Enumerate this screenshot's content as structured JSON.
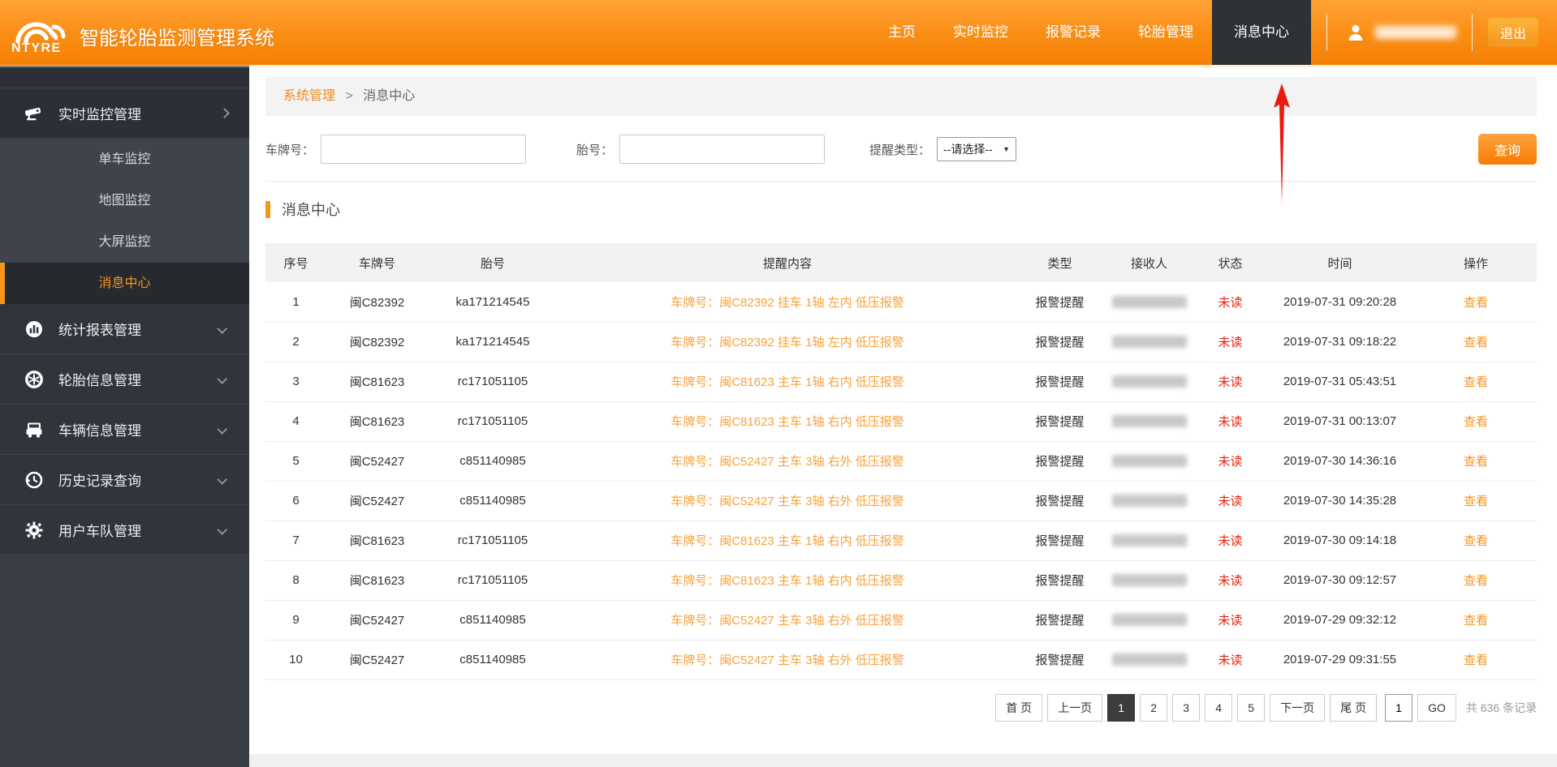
{
  "colors": {
    "accent_orange": "#f7941d",
    "header_gradient_top": "#ffa235",
    "header_gradient_bottom": "#f67f06",
    "active_tab_bg": "#2e3236",
    "status_red": "#e8240c",
    "sidebar_bg": "#383d44",
    "annotation_arrow": "#ea1b0c"
  },
  "header": {
    "logo_text": "NTYRE",
    "app_title": "智能轮胎监测管理系统",
    "nav": [
      {
        "label": "主页",
        "active": false
      },
      {
        "label": "实时监控",
        "active": false
      },
      {
        "label": "报警记录",
        "active": false
      },
      {
        "label": "轮胎管理",
        "active": false
      },
      {
        "label": "消息中心",
        "active": true
      }
    ],
    "username_redacted": true,
    "logout_label": "退出"
  },
  "sidebar": {
    "groups": [
      {
        "label": "实时监控管理",
        "icon": "cctv-camera",
        "expanded": true,
        "children": [
          {
            "label": "单车监控",
            "active": false
          },
          {
            "label": "地图监控",
            "active": false
          },
          {
            "label": "大屏监控",
            "active": false
          },
          {
            "label": "消息中心",
            "active": true
          }
        ]
      },
      {
        "label": "统计报表管理",
        "icon": "bar-chart",
        "expanded": false
      },
      {
        "label": "轮胎信息管理",
        "icon": "tire",
        "expanded": false
      },
      {
        "label": "车辆信息管理",
        "icon": "truck",
        "expanded": false
      },
      {
        "label": "历史记录查询",
        "icon": "history",
        "expanded": false
      },
      {
        "label": "用户车队管理",
        "icon": "gear",
        "expanded": false
      }
    ]
  },
  "breadcrumb": {
    "parent": "系统管理",
    "separator": ">",
    "current": "消息中心"
  },
  "filters": {
    "plate_label": "车牌号：",
    "tire_label": "胎号：",
    "type_label": "提醒类型：",
    "type_value": "--请选择--",
    "search_label": "查询"
  },
  "section": {
    "title": "消息中心"
  },
  "table": {
    "columns": [
      "序号",
      "车牌号",
      "胎号",
      "提醒内容",
      "类型",
      "接收人",
      "状态",
      "时间",
      "操作"
    ],
    "rows": [
      {
        "no": "1",
        "plate": "闽C82392",
        "tire": "ka171214545",
        "content": "车牌号：闽C82392 挂车 1轴 左内 低压报警",
        "type": "报警提醒",
        "receiver_redacted": true,
        "status": "未读",
        "time": "2019-07-31 09:20:28",
        "action": "查看"
      },
      {
        "no": "2",
        "plate": "闽C82392",
        "tire": "ka171214545",
        "content": "车牌号：闽C82392 挂车 1轴 左内 低压报警",
        "type": "报警提醒",
        "receiver_redacted": true,
        "status": "未读",
        "time": "2019-07-31 09:18:22",
        "action": "查看"
      },
      {
        "no": "3",
        "plate": "闽C81623",
        "tire": "rc171051105",
        "content": "车牌号：闽C81623 主车 1轴 右内 低压报警",
        "type": "报警提醒",
        "receiver_redacted": true,
        "status": "未读",
        "time": "2019-07-31 05:43:51",
        "action": "查看"
      },
      {
        "no": "4",
        "plate": "闽C81623",
        "tire": "rc171051105",
        "content": "车牌号：闽C81623 主车 1轴 右内 低压报警",
        "type": "报警提醒",
        "receiver_redacted": true,
        "status": "未读",
        "time": "2019-07-31 00:13:07",
        "action": "查看"
      },
      {
        "no": "5",
        "plate": "闽C52427",
        "tire": "c851140985",
        "content": "车牌号：闽C52427 主车 3轴 右外 低压报警",
        "type": "报警提醒",
        "receiver_redacted": true,
        "status": "未读",
        "time": "2019-07-30 14:36:16",
        "action": "查看"
      },
      {
        "no": "6",
        "plate": "闽C52427",
        "tire": "c851140985",
        "content": "车牌号：闽C52427 主车 3轴 右外 低压报警",
        "type": "报警提醒",
        "receiver_redacted": true,
        "status": "未读",
        "time": "2019-07-30 14:35:28",
        "action": "查看"
      },
      {
        "no": "7",
        "plate": "闽C81623",
        "tire": "rc171051105",
        "content": "车牌号：闽C81623 主车 1轴 右内 低压报警",
        "type": "报警提醒",
        "receiver_redacted": true,
        "status": "未读",
        "time": "2019-07-30 09:14:18",
        "action": "查看"
      },
      {
        "no": "8",
        "plate": "闽C81623",
        "tire": "rc171051105",
        "content": "车牌号：闽C81623 主车 1轴 右内 低压报警",
        "type": "报警提醒",
        "receiver_redacted": true,
        "status": "未读",
        "time": "2019-07-30 09:12:57",
        "action": "查看"
      },
      {
        "no": "9",
        "plate": "闽C52427",
        "tire": "c851140985",
        "content": "车牌号：闽C52427 主车 3轴 右外 低压报警",
        "type": "报警提醒",
        "receiver_redacted": true,
        "status": "未读",
        "time": "2019-07-29 09:32:12",
        "action": "查看"
      },
      {
        "no": "10",
        "plate": "闽C52427",
        "tire": "c851140985",
        "content": "车牌号：闽C52427 主车 3轴 右外 低压报警",
        "type": "报警提醒",
        "receiver_redacted": true,
        "status": "未读",
        "time": "2019-07-29 09:31:55",
        "action": "查看"
      }
    ]
  },
  "pagination": {
    "first": "首 页",
    "prev": "上一页",
    "pages": [
      "1",
      "2",
      "3",
      "4",
      "5"
    ],
    "active_page": "1",
    "next": "下一页",
    "last": "尾 页",
    "goto_value": "1",
    "go_label": "GO",
    "total_text": "共 636 条记录"
  }
}
